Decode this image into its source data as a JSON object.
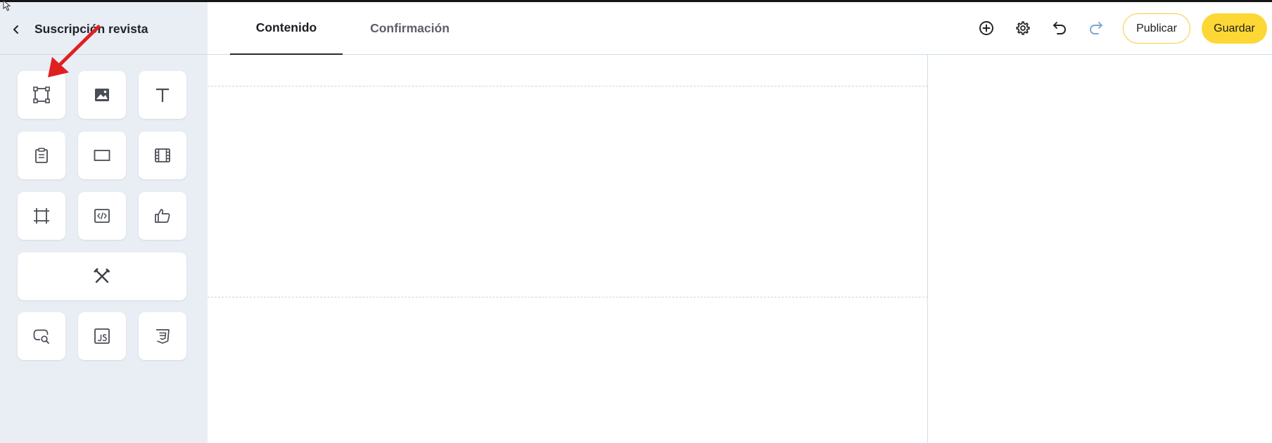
{
  "sidebar": {
    "title": "Suscripción revista",
    "tools": [
      {
        "icon": "container-frame-icon"
      },
      {
        "icon": "image-icon"
      },
      {
        "icon": "text-icon"
      },
      {
        "icon": "clipboard-icon"
      },
      {
        "icon": "rectangle-icon"
      },
      {
        "icon": "video-film-icon"
      },
      {
        "icon": "crop-frame-icon"
      },
      {
        "icon": "code-embed-icon"
      },
      {
        "icon": "thumbs-up-icon"
      },
      {
        "icon": "tools-wrench-icon"
      },
      {
        "icon": "search-bubble-icon"
      },
      {
        "icon": "javascript-icon"
      },
      {
        "icon": "css3-icon"
      }
    ]
  },
  "tabs": [
    {
      "label": "Contenido",
      "active": true
    },
    {
      "label": "Confirmación",
      "active": false
    }
  ],
  "toolbar": {
    "icons": [
      "add-circle-icon",
      "settings-gear-icon",
      "undo-icon",
      "redo-icon"
    ],
    "publish_label": "Publicar",
    "save_label": "Guardar"
  },
  "colors": {
    "accent_yellow": "#fdd835",
    "sidebar_bg": "#e9edf4",
    "annotation_arrow": "#e02020",
    "redo_disabled": "#7aa7d6"
  }
}
